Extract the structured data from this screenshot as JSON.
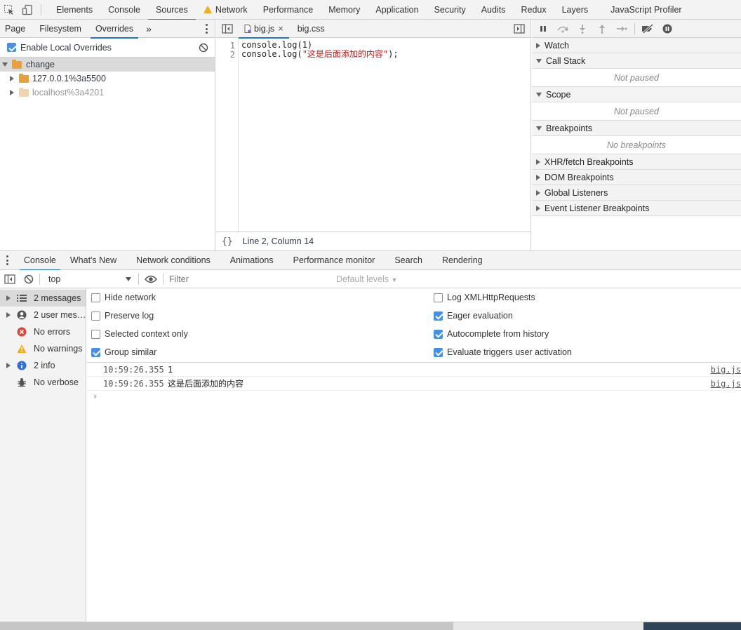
{
  "main_tabs": [
    "Elements",
    "Console",
    "Sources",
    "Network",
    "Performance",
    "Memory",
    "Application",
    "Security",
    "Audits",
    "Redux",
    "Layers",
    "JavaScript Profiler"
  ],
  "navigator": {
    "tabs": [
      "Page",
      "Filesystem",
      "Overrides"
    ],
    "more": "»",
    "enable_overrides_label": "Enable Local Overrides",
    "tree": {
      "root": "change",
      "children": [
        "127.0.0.1%3a5500",
        "localhost%3a4201"
      ]
    }
  },
  "editor": {
    "tabs": [
      "big.js",
      "big.css"
    ],
    "close_glyph": "×",
    "lines": [
      {
        "no": "1",
        "prefix": "console.log(1)",
        "string": "",
        "suffix": ""
      },
      {
        "no": "2",
        "prefix": "console.log(",
        "string": "\"这是后面添加的内容\"",
        "suffix": ");"
      }
    ],
    "format_glyph": "{}",
    "status": "Line 2, Column 14"
  },
  "debugger": {
    "sections": [
      {
        "title": "Watch",
        "expanded": false,
        "body": ""
      },
      {
        "title": "Call Stack",
        "expanded": true,
        "body": "Not paused"
      },
      {
        "title": "Scope",
        "expanded": true,
        "body": "Not paused"
      },
      {
        "title": "Breakpoints",
        "expanded": true,
        "body": "No breakpoints"
      },
      {
        "title": "XHR/fetch Breakpoints",
        "expanded": false,
        "body": ""
      },
      {
        "title": "DOM Breakpoints",
        "expanded": false,
        "body": ""
      },
      {
        "title": "Global Listeners",
        "expanded": false,
        "body": ""
      },
      {
        "title": "Event Listener Breakpoints",
        "expanded": false,
        "body": ""
      }
    ]
  },
  "drawer_tabs": [
    "Console",
    "What's New",
    "Network conditions",
    "Animations",
    "Performance monitor",
    "Search",
    "Rendering"
  ],
  "console": {
    "context": "top",
    "filter_placeholder": "Filter",
    "levels": "Default levels",
    "sidebar": [
      "2 messages",
      "2 user mes…",
      "No errors",
      "No warnings",
      "2 info",
      "No verbose"
    ],
    "settings_left": [
      {
        "label": "Hide network",
        "checked": false
      },
      {
        "label": "Preserve log",
        "checked": false
      },
      {
        "label": "Selected context only",
        "checked": false
      },
      {
        "label": "Group similar",
        "checked": true
      }
    ],
    "settings_right": [
      {
        "label": "Log XMLHttpRequests",
        "checked": false
      },
      {
        "label": "Eager evaluation",
        "checked": true
      },
      {
        "label": "Autocomplete from history",
        "checked": true
      },
      {
        "label": "Evaluate triggers user activation",
        "checked": true
      }
    ],
    "messages": [
      {
        "time": "10:59:26.355",
        "text": "1",
        "source": "big.js"
      },
      {
        "time": "10:59:26.355",
        "text": "这是后面添加的内容",
        "source": "big.js"
      }
    ],
    "prompt": "›"
  },
  "colors": {
    "accent": "#1a73e8",
    "checkbox": "#4a90e2",
    "error": "#e0453a",
    "warning": "#f0ad1e",
    "info": "#2f6fd6"
  }
}
